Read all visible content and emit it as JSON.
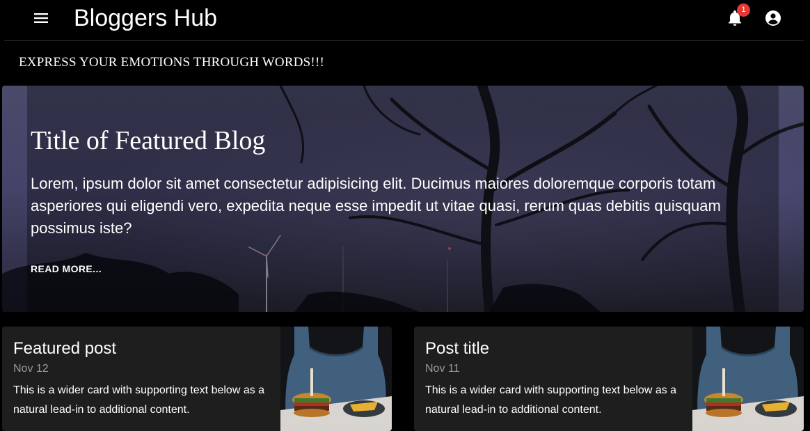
{
  "appbar": {
    "title": "Bloggers Hub",
    "notification_count": "1",
    "icons": {
      "menu": "menu-icon",
      "bell": "bell-icon",
      "account": "account-circle-icon"
    }
  },
  "tagline": "EXPRESS YOUR EMOTIONS THROUGH WORDS!!!",
  "featured": {
    "title": "Title of Featured Blog",
    "text": "Lorem, ipsum dolor sit amet consectetur adipisicing elit. Ducimus maiores doloremque corporis totam asperiores qui eligendi vero, expedita neque esse impedit ut vitae quasi, rerum quas debitis quisquam possimus iste?",
    "link": "READ MORE..."
  },
  "posts": [
    {
      "title": "Featured post",
      "date": "Nov 12",
      "text": "This is a wider card with supporting text below as a natural lead-in to additional content."
    },
    {
      "title": "Post title",
      "date": "Nov 11",
      "text": "This is a wider card with supporting text below as a natural lead-in to additional content."
    }
  ],
  "colors": {
    "background": "#000000",
    "card": "#1e1e1e",
    "badge": "#e53935",
    "muted_text": "#9a9a9a"
  }
}
